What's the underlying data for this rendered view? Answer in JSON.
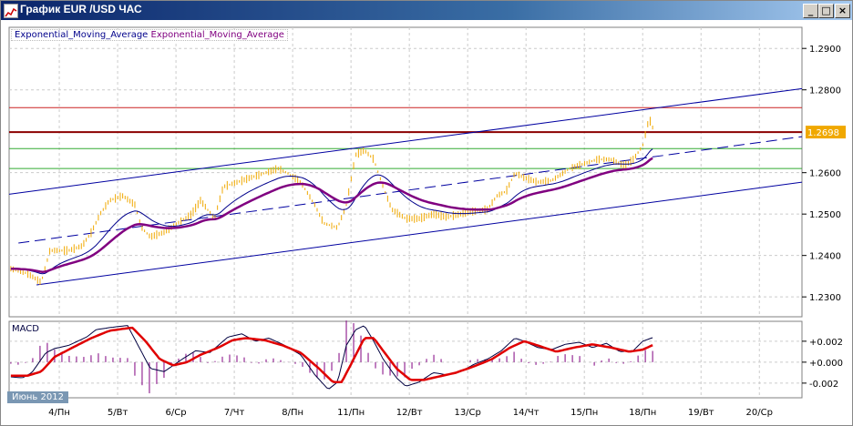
{
  "window": {
    "title": "График EUR /USD  ЧАС",
    "buttons": [
      "minimize",
      "maximize",
      "close"
    ]
  },
  "legend": {
    "ema1": "Exponential_Moving_Average",
    "ema2": "Exponential_Moving_Average",
    "ema1_color": "#00008b",
    "ema2_color": "#800080"
  },
  "month_label": "Июнь 2012",
  "current_price": "1.2698",
  "colors": {
    "price": "#f0a800",
    "channel": "#0000a0",
    "resistance": "#cc2222",
    "level": "#8b0000",
    "support": "#33aa33",
    "macd": "#000040",
    "signal": "#e00000",
    "histogram": "#800080",
    "current_badge": "#f0a800"
  },
  "chart_data": [
    {
      "type": "line",
      "name": "price",
      "ylim": [
        1.2252,
        1.2951
      ],
      "xlim": [
        -0.86,
        12.73
      ],
      "y_ticks": [
        "1.2900",
        "1.2800",
        "1.2600",
        "1.2500",
        "1.2400",
        "1.2300"
      ],
      "x_ticks": [
        "4/Пн",
        "5/Вт",
        "6/Ср",
        "7/Чт",
        "8/Пн",
        "11/Пн",
        "12/Вт",
        "13/Ср",
        "14/Чт",
        "15/Пн",
        "18/Пн",
        "19/Вт",
        "20/Ср"
      ],
      "x": [
        -0.83,
        -0.55,
        -0.31,
        -0.16,
        0.16,
        0.39,
        0.55,
        0.7,
        0.86,
        1.09,
        1.3,
        1.41,
        1.56,
        1.8,
        2.03,
        2.27,
        2.42,
        2.66,
        2.81,
        3.05,
        3.28,
        3.52,
        3.75,
        3.91,
        4.14,
        4.38,
        4.53,
        4.77,
        4.92,
        5.08,
        5.23,
        5.39,
        5.55,
        5.7,
        5.94,
        6.17,
        6.41,
        6.64,
        6.88,
        7.11,
        7.34,
        7.5,
        7.66,
        7.81,
        7.97,
        8.2,
        8.44,
        8.59,
        8.75,
        8.98,
        9.22,
        9.45,
        9.69,
        9.84,
        10.0,
        10.11,
        10.2
      ],
      "values": [
        1.2368,
        1.2357,
        1.2335,
        1.2412,
        1.2412,
        1.2423,
        1.2456,
        1.25,
        1.2533,
        1.2544,
        1.2522,
        1.2467,
        1.2445,
        1.2456,
        1.2478,
        1.25,
        1.2533,
        1.2489,
        1.2566,
        1.2577,
        1.2588,
        1.2599,
        1.261,
        1.2599,
        1.2577,
        1.2522,
        1.2478,
        1.2467,
        1.2522,
        1.2643,
        1.2654,
        1.2632,
        1.2566,
        1.2511,
        1.2489,
        1.2489,
        1.25,
        1.2493,
        1.25,
        1.2507,
        1.2511,
        1.2544,
        1.2555,
        1.2599,
        1.2588,
        1.2577,
        1.2581,
        1.2595,
        1.261,
        1.2621,
        1.2632,
        1.2632,
        1.2616,
        1.2632,
        1.2665,
        1.2731,
        1.2698
      ],
      "horizontal_lines": [
        1.2757,
        1.2698,
        1.2658,
        1.261
      ],
      "channel": [
        {
          "from": [
            -0.86,
            1.2548
          ],
          "to": [
            12.73,
            1.2803
          ]
        },
        {
          "from": [
            -0.7,
            1.243
          ],
          "to": [
            12.73,
            1.2687
          ],
          "dashed": true
        },
        {
          "from": [
            -0.39,
            1.2329
          ],
          "to": [
            12.73,
            1.2577
          ]
        }
      ]
    },
    {
      "type": "line",
      "name": "MACD",
      "title": "MACD",
      "ylim": [
        -0.0034,
        0.0039
      ],
      "y_ticks": [
        "+0.002",
        "+0.000",
        "-0.002"
      ],
      "macd": {
        "x": [
          -0.83,
          -0.63,
          -0.47,
          -0.23,
          -0.08,
          0.16,
          0.47,
          0.63,
          0.86,
          1.17,
          1.56,
          1.8,
          2.11,
          2.34,
          2.58,
          2.89,
          3.13,
          3.36,
          3.59,
          3.83,
          4.14,
          4.38,
          4.61,
          4.77,
          4.92,
          5.08,
          5.23,
          5.39,
          5.55,
          5.78,
          5.94,
          6.17,
          6.41,
          6.64,
          6.88,
          7.11,
          7.34,
          7.58,
          7.81,
          7.97,
          8.2,
          8.44,
          8.67,
          8.91,
          9.14,
          9.38,
          9.61,
          9.84,
          10.0,
          10.2
        ],
        "values": [
          -0.0014,
          -0.0015,
          -0.001,
          0.0009,
          0.0013,
          0.0016,
          0.0024,
          0.0031,
          0.0033,
          0.0035,
          -0.0006,
          -0.0009,
          0.0003,
          0.0011,
          0.0009,
          0.0024,
          0.0027,
          0.002,
          0.0023,
          0.0017,
          0.0007,
          -0.0012,
          -0.0026,
          -0.0019,
          0.0016,
          0.0031,
          0.0035,
          0.002,
          0.0003,
          -0.0015,
          -0.0023,
          -0.0019,
          -0.001,
          -0.0012,
          -0.0009,
          -0.0002,
          0.0003,
          0.0011,
          0.0023,
          0.002,
          0.0014,
          0.0012,
          0.0017,
          0.0019,
          0.0014,
          0.0018,
          0.001,
          0.0011,
          0.002,
          0.0024
        ]
      },
      "signal": {
        "x": [
          -0.83,
          -0.55,
          -0.31,
          -0.08,
          0.23,
          0.55,
          0.86,
          1.25,
          1.48,
          1.72,
          1.95,
          2.19,
          2.42,
          2.73,
          2.97,
          3.2,
          3.52,
          3.83,
          4.14,
          4.45,
          4.69,
          4.84,
          5.0,
          5.23,
          5.39,
          5.55,
          5.78,
          6.02,
          6.25,
          6.48,
          6.8,
          7.11,
          7.42,
          7.73,
          7.97,
          8.2,
          8.52,
          8.83,
          9.14,
          9.45,
          9.77,
          10.0,
          10.2
        ],
        "values": [
          -0.0013,
          -0.0013,
          -0.0009,
          0.0005,
          0.0014,
          0.0023,
          0.003,
          0.0033,
          0.002,
          0.0003,
          -0.0003,
          0.0,
          0.0007,
          0.0014,
          0.0021,
          0.0023,
          0.0021,
          0.0016,
          0.0009,
          -0.0006,
          -0.0019,
          -0.0019,
          -0.0002,
          0.0023,
          0.0023,
          0.0011,
          -0.0006,
          -0.0017,
          -0.0017,
          -0.0014,
          -0.001,
          -0.0004,
          0.0003,
          0.0014,
          0.002,
          0.0016,
          0.001,
          0.0014,
          0.0017,
          0.0014,
          0.001,
          0.0012,
          0.0017
        ]
      }
    }
  ]
}
